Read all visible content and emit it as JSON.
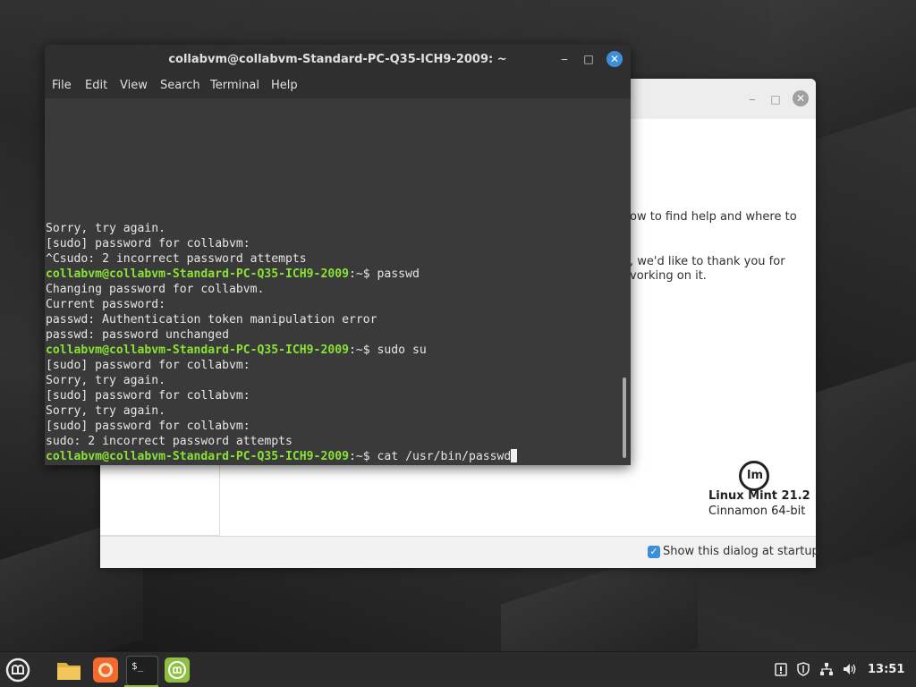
{
  "welcome": {
    "text_1": "ow to find help and where to",
    "text_2": ", we'd like to thank you for",
    "text_3": "vorking on it.",
    "logo_glyph": "lm",
    "version": "Linux Mint 21.2",
    "edition": "Cinnamon 64-bit",
    "show_at_startup_label": "Show this dialog at startup",
    "show_at_startup_checked": true,
    "minimize_glyph": "‒",
    "maximize_glyph": "□",
    "close_glyph": "✕"
  },
  "terminal": {
    "title": "collabvm@collabvm-Standard-PC-Q35-ICH9-2009: ~",
    "minimize_glyph": "‒",
    "maximize_glyph": "□",
    "close_glyph": "✕",
    "menu": [
      "File",
      "Edit",
      "View",
      "Search",
      "Terminal",
      "Help"
    ],
    "lines": [
      {
        "text": "Sorry, try again."
      },
      {
        "text": "[sudo] password for collabvm:"
      },
      {
        "text": "^Csudo: 2 incorrect password attempts"
      },
      {
        "prompt": "collabvm@collabvm-Standard-PC-Q35-ICH9-2009",
        "suffix": ":~$ ",
        "command": "passwd"
      },
      {
        "text": "Changing password for collabvm."
      },
      {
        "text": "Current password:"
      },
      {
        "text": "passwd: Authentication token manipulation error"
      },
      {
        "text": "passwd: password unchanged"
      },
      {
        "prompt": "collabvm@collabvm-Standard-PC-Q35-ICH9-2009",
        "suffix": ":~$ ",
        "command": "sudo su"
      },
      {
        "text": "[sudo] password for collabvm:"
      },
      {
        "text": "Sorry, try again."
      },
      {
        "text": "[sudo] password for collabvm:"
      },
      {
        "text": "Sorry, try again."
      },
      {
        "text": "[sudo] password for collabvm:"
      },
      {
        "text": "sudo: 2 incorrect password attempts"
      },
      {
        "prompt": "collabvm@collabvm-Standard-PC-Q35-ICH9-2009",
        "suffix": ":~$ ",
        "command": "cat /usr/bin/passwd"
      }
    ]
  },
  "taskbar": {
    "apps": [
      "mint-menu-icon",
      "files-icon",
      "firefox-icon",
      "terminal-icon",
      "mint-welcome-icon"
    ],
    "terminal_glyph": "$_",
    "clock": "13:51",
    "tray": [
      "update-icon",
      "shield-icon",
      "network-icon",
      "volume-icon"
    ]
  },
  "colors": {
    "prompt": "#8ae234",
    "accent": "#3d8fd9",
    "mint_green": "#8fbf41",
    "firefox_orange": "#f36b2c"
  }
}
